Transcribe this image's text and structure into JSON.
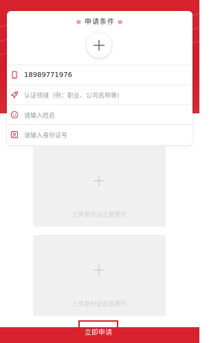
{
  "form": {
    "section_title": "申请条件",
    "phone_value": "18989771976",
    "field_domain_placeholder": "认证领域（例：职业、公司名称等）",
    "field_name_placeholder": "请输入姓名",
    "field_id_placeholder": "请输入身份证号"
  },
  "uploads": {
    "front_label": "上传身份证正面照片",
    "back_label": "上传身份证反面照片"
  },
  "actions": {
    "submit_label": "立即申请"
  },
  "colors": {
    "accent": "#d8232f"
  }
}
